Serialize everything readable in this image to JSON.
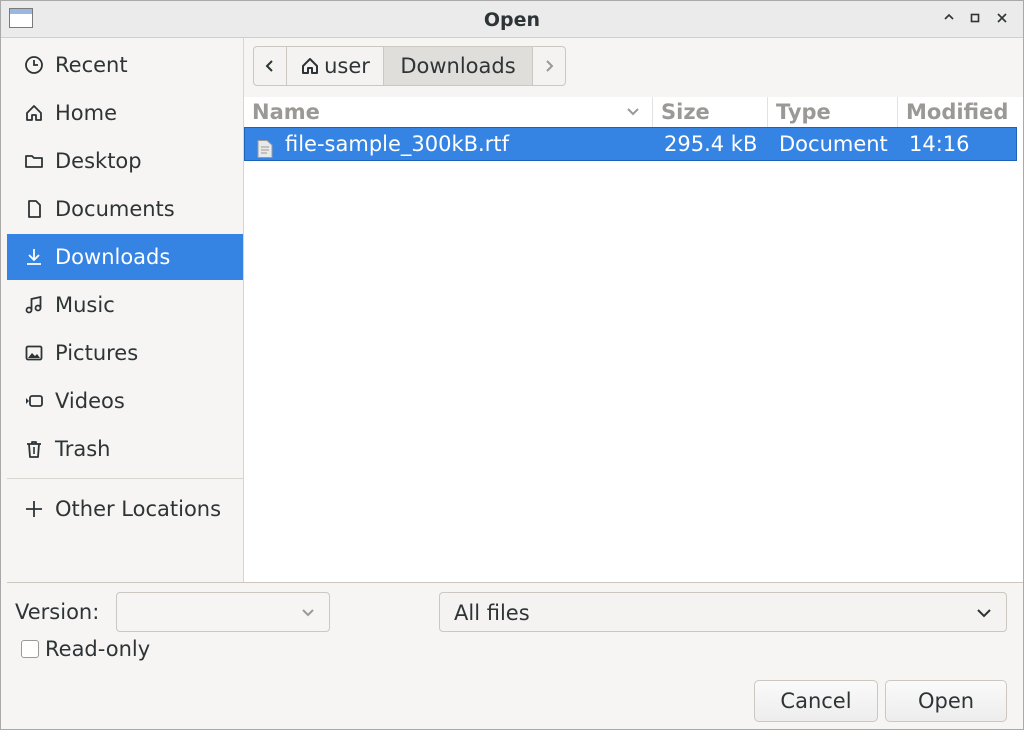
{
  "window": {
    "title": "Open",
    "controls": {
      "minimize": "⎯",
      "maximize": "□",
      "close": "✕"
    }
  },
  "sidebar": {
    "items": [
      {
        "label": "Recent",
        "icon": "clock-icon"
      },
      {
        "label": "Home",
        "icon": "home-icon"
      },
      {
        "label": "Desktop",
        "icon": "folder-icon"
      },
      {
        "label": "Documents",
        "icon": "document-icon"
      },
      {
        "label": "Downloads",
        "icon": "download-icon",
        "active": true
      },
      {
        "label": "Music",
        "icon": "music-note-icon"
      },
      {
        "label": "Pictures",
        "icon": "picture-icon"
      },
      {
        "label": "Videos",
        "icon": "video-camera-icon"
      },
      {
        "label": "Trash",
        "icon": "trash-icon"
      }
    ],
    "other_locations": {
      "label": "Other Locations",
      "icon": "plus-icon"
    }
  },
  "pathbar": {
    "back": "‹",
    "home_label": "user",
    "current": "Downloads",
    "forward": "›"
  },
  "filelist": {
    "columns": {
      "name": "Name",
      "size": "Size",
      "type": "Type",
      "modified": "Modified"
    },
    "rows": [
      {
        "name": "file-sample_300kB.rtf",
        "size": "295.4 kB",
        "type": "Document",
        "modified": "14:16",
        "selected": true
      }
    ]
  },
  "footer": {
    "version_label": "Version:",
    "version_value": "",
    "filter_value": "All files",
    "readonly_label": "Read-only",
    "readonly_checked": false,
    "cancel_label": "Cancel",
    "open_label": "Open"
  },
  "colors": {
    "accent": "#3584e4",
    "background": "#f6f5f4"
  }
}
